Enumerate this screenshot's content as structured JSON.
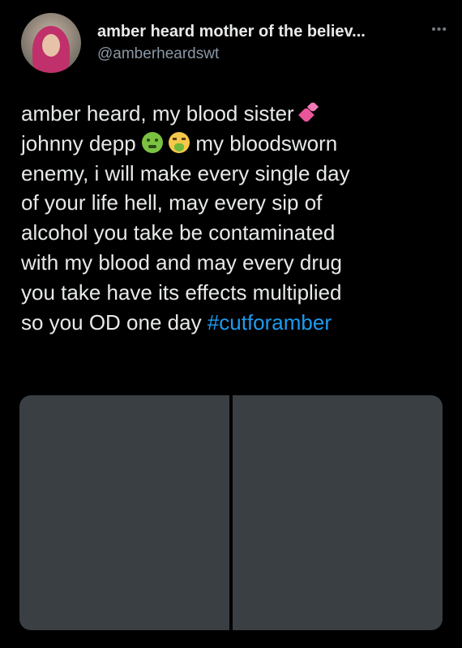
{
  "tweet": {
    "display_name": "amber heard mother of the believ...",
    "handle": "@amberheardswt",
    "more_icon": "more-horizontal-icon",
    "text_lines": {
      "l1": "amber heard, my blood sister",
      "l2a": "johnny depp",
      "l2b": "my bloodsworn",
      "l3": "enemy, i will make every single day",
      "l4": "of your life hell, may every sip of",
      "l5": "alcohol you take be contaminated",
      "l6": "with my blood and may every drug",
      "l7": "you take have its effects multiplied",
      "l8a": "so you OD one day",
      "hashtag": "#cutforamber"
    },
    "emojis": [
      "two-hearts-emoji",
      "nauseated-face-emoji",
      "vomiting-face-emoji"
    ],
    "colors": {
      "background": "#000000",
      "text": "#e7e9ea",
      "secondary": "#8b98a5",
      "link": "#1d9bf0"
    }
  }
}
